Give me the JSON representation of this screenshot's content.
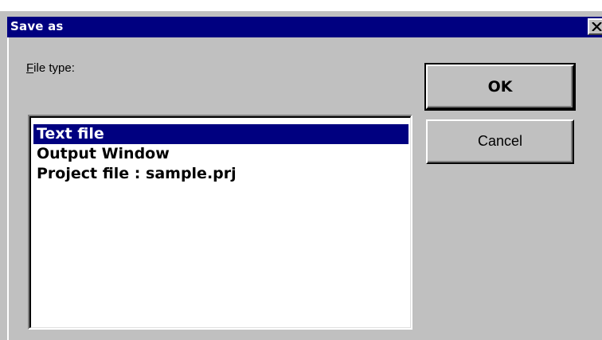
{
  "dialog": {
    "title": "Save as",
    "close_icon": "close-icon"
  },
  "file_type": {
    "label_mnemonic": "F",
    "label_rest": "ile type:",
    "items": [
      {
        "label": "Text file",
        "selected": true
      },
      {
        "label": "Output Window",
        "selected": false
      },
      {
        "label": "Project file : sample.prj",
        "selected": false
      }
    ]
  },
  "buttons": {
    "ok_label": "OK",
    "cancel_label": "Cancel"
  },
  "colors": {
    "title_bar": "#000080",
    "face": "#c0c0c0",
    "selection": "#000080"
  }
}
